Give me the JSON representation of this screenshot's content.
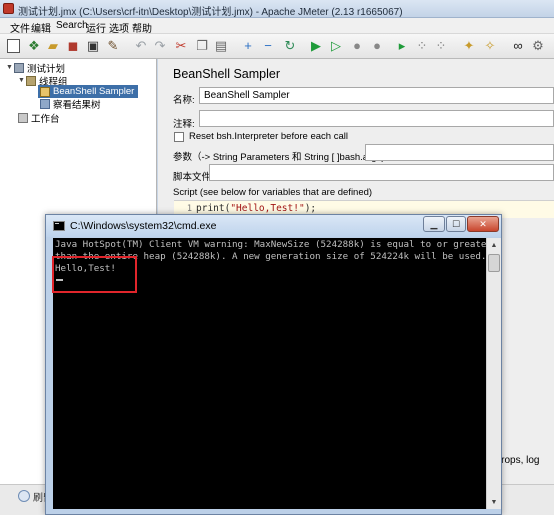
{
  "window": {
    "title": "测试计划.jmx (C:\\Users\\crf-itn\\Desktop\\测试计划.jmx) - Apache JMeter (2.13 r1665067)"
  },
  "menu": [
    "文件",
    "编辑",
    "Search",
    "运行",
    "选项",
    "帮助"
  ],
  "tree": {
    "items": [
      {
        "label": "测试计划"
      },
      {
        "label": "线程组"
      },
      {
        "label": "BeanShell Sampler"
      },
      {
        "label": "察看结果树"
      },
      {
        "label": "工作台"
      }
    ]
  },
  "sampler": {
    "heading": "BeanShell Sampler",
    "name_label": "名称:",
    "name_value": "BeanShell Sampler",
    "comment_label": "注释:",
    "comment_value": "",
    "reset_label": "Reset bsh.Interpreter before each call",
    "params_label": "参数（-> String Parameters 和 String [ ]bash.args)",
    "params_value": "",
    "script_file_label": "脚本文件",
    "script_file_value": "",
    "script_label": "Script (see below for variables that are defined)",
    "code_line_number": "1",
    "code_fn": "print(",
    "code_str": "\"Hello,Test!\"",
    "code_end": ");"
  },
  "cut_text": "s, props, log",
  "status_text": "刷留",
  "cmd": {
    "title": "C:\\Windows\\system32\\cmd.exe",
    "lines": [
      "Java HotSpot(TM) Client VM warning: MaxNewSize (524288k) is equal to or greater",
      "than the entire heap (524288k).  A new generation size of 524224k will be used.",
      "Hello,Test!"
    ]
  },
  "colors": {
    "cmd_bg": "#000000",
    "cmd_text": "#c0c0c0",
    "highlight": "#e0252b",
    "tree_selected": "#3d6fa8"
  }
}
